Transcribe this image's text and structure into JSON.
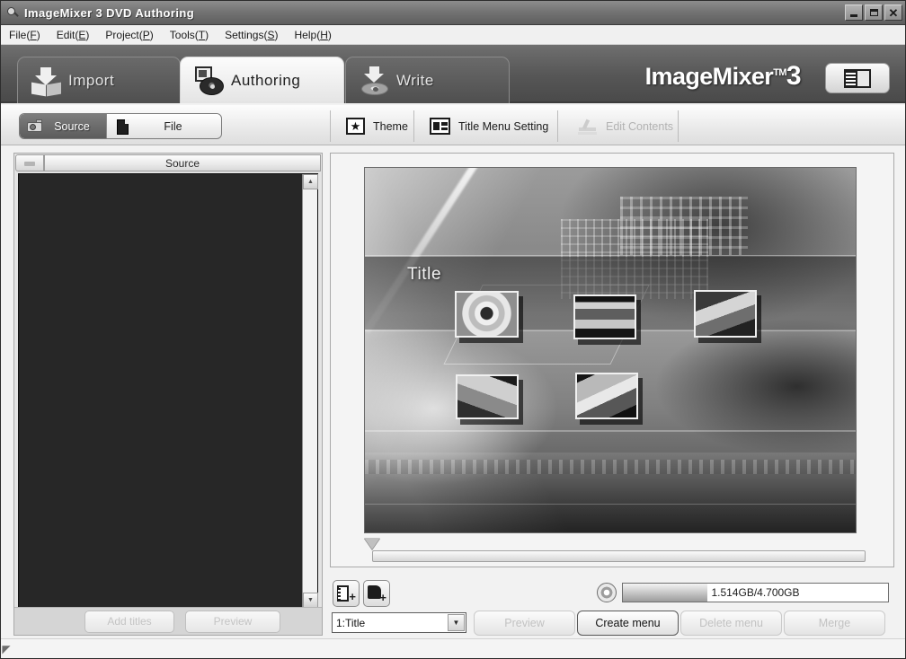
{
  "window": {
    "title": "ImageMixer 3 DVD Authoring",
    "icon": "camera-icon",
    "minimize": "_",
    "maximize": "□",
    "close": "✕"
  },
  "menubar": {
    "items": [
      {
        "label": "File",
        "mnemonic": "F"
      },
      {
        "label": "Edit",
        "mnemonic": "E"
      },
      {
        "label": "Project",
        "mnemonic": "P"
      },
      {
        "label": "Tools",
        "mnemonic": "T"
      },
      {
        "label": "Settings",
        "mnemonic": "S"
      },
      {
        "label": "Help",
        "mnemonic": "H"
      }
    ]
  },
  "main_tabs": [
    {
      "label": "Import",
      "icon": "import-icon",
      "active": false
    },
    {
      "label": "Authoring",
      "icon": "authoring-disc-icon",
      "active": true
    },
    {
      "label": "Write",
      "icon": "write-disc-icon",
      "active": false
    }
  ],
  "brand": {
    "name": "ImageMixer",
    "tm": "TM",
    "version": "3",
    "panel_button": "layout-toggle-icon"
  },
  "subtoolbar": {
    "segments": [
      {
        "label": "Source",
        "icon": "camcorder-icon",
        "selected": true
      },
      {
        "label": "File",
        "icon": "file-icon",
        "selected": false
      }
    ],
    "buttons": [
      {
        "label": "Theme",
        "icon": "star-icon",
        "enabled": true
      },
      {
        "label": "Title Menu Setting",
        "icon": "menu-layout-icon",
        "enabled": true
      },
      {
        "label": "Edit Contents",
        "icon": "edit-contents-icon",
        "enabled": false
      }
    ]
  },
  "left_panel": {
    "header": "Source",
    "header_icon": "collapse-icon",
    "scrollbar": {
      "up": "▲",
      "down": "▼"
    },
    "buttons": [
      {
        "label": "Add titles",
        "enabled": false
      },
      {
        "label": "Preview",
        "enabled": false
      }
    ]
  },
  "preview": {
    "menu_title": "Title",
    "thumbnails": [
      {
        "name": "sunflower-thumbnail"
      },
      {
        "name": "scene-thumbnail"
      },
      {
        "name": "person-thumbnail"
      },
      {
        "name": "dog-thumbnail"
      },
      {
        "name": "child-thumbnail"
      }
    ],
    "scrubber": {
      "position": 0
    }
  },
  "bottom": {
    "add_video": {
      "icon": "add-video-icon"
    },
    "add_photo": {
      "icon": "add-photo-icon"
    },
    "disc_icon": "disc-icon",
    "capacity_text": "1.514GB/4.700GB",
    "capacity_percent": 32,
    "title_select": {
      "value": "1:Title",
      "chevron": "▼"
    },
    "buttons": [
      {
        "label": "Preview",
        "enabled": false
      },
      {
        "label": "Create menu",
        "enabled": true
      },
      {
        "label": "Delete menu",
        "enabled": false
      },
      {
        "label": "Merge",
        "enabled": false
      }
    ]
  },
  "status": {
    "grip": "◤"
  },
  "colors": {
    "titlebar": "#747474",
    "tabstrip": "#565656",
    "active_tab": "#f4f4f4",
    "source_bg": "#272727",
    "accent": "#5c5c5c"
  }
}
